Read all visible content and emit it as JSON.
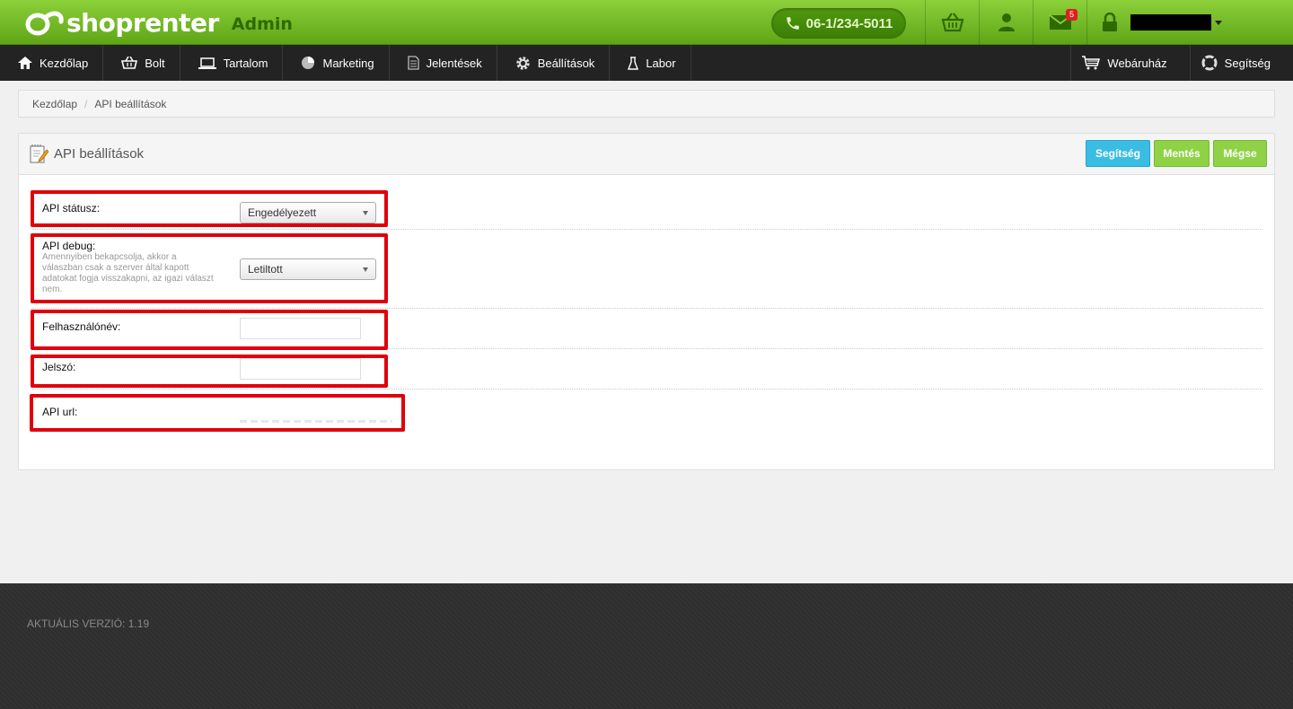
{
  "header": {
    "logo_text": "shoprenter",
    "logo_admin": "Admin",
    "phone": "06-1/234-5011",
    "messages_badge": "5",
    "icons": [
      "basket-icon",
      "user-icon",
      "mail-icon",
      "lock-icon"
    ]
  },
  "nav": {
    "items": [
      {
        "label": "Kezdőlap",
        "icon": "home-icon"
      },
      {
        "label": "Bolt",
        "icon": "basket-icon"
      },
      {
        "label": "Tartalom",
        "icon": "laptop-icon"
      },
      {
        "label": "Marketing",
        "icon": "pie-chart-icon"
      },
      {
        "label": "Jelentések",
        "icon": "document-icon"
      },
      {
        "label": "Beállítások",
        "icon": "gear-icon"
      },
      {
        "label": "Labor",
        "icon": "flask-icon"
      }
    ],
    "right_items": [
      {
        "label": "Webáruház",
        "icon": "cart-icon"
      },
      {
        "label": "Segítség",
        "icon": "lifebuoy-icon"
      }
    ]
  },
  "breadcrumb": {
    "home": "Kezdőlap",
    "current": "API beállítások"
  },
  "panel": {
    "title": "API beállítások",
    "buttons": {
      "help": "Segítség",
      "save": "Mentés",
      "cancel": "Mégse"
    }
  },
  "form": {
    "api_status": {
      "label": "API státusz:",
      "value": "Engedélyezett"
    },
    "api_debug": {
      "label": "API debug:",
      "help": "Amennyiben bekapcsolja, akkor a válaszban csak a szerver által kapott adatokat fogja visszakapni, az igazi választ nem.",
      "value": "Letiltott"
    },
    "username": {
      "label": "Felhasználónév:",
      "value": ""
    },
    "password": {
      "label": "Jelszó:",
      "value": ""
    },
    "api_url": {
      "label": "API url:"
    }
  },
  "footer": {
    "version": "AKTUÁLIS VERZIÓ: 1.19"
  },
  "colors": {
    "brand_green": "#7cc52a",
    "nav_bg": "#232323",
    "highlight_red": "#e0000b",
    "help_blue": "#3bbde3"
  }
}
